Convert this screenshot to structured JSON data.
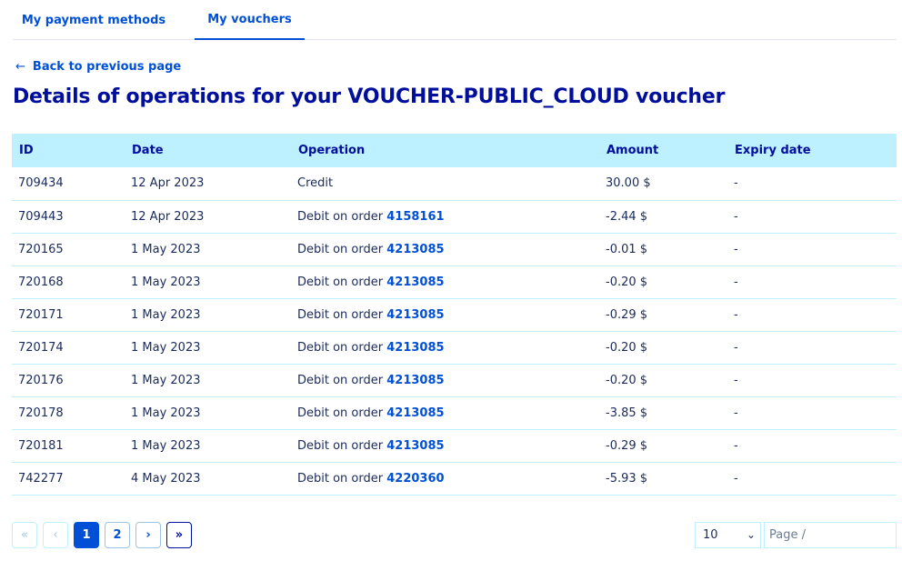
{
  "tabs": [
    {
      "label": "My payment methods"
    },
    {
      "label": "My vouchers"
    }
  ],
  "back_link": {
    "label": "Back to previous page"
  },
  "page_title": "Details of operations for your VOUCHER-PUBLIC_CLOUD voucher",
  "table": {
    "headers": [
      "ID",
      "Date",
      "Operation",
      "Amount",
      "Expiry date"
    ],
    "rows": [
      {
        "id": "709434",
        "date": "12 Apr 2023",
        "operation": "Credit",
        "order": "",
        "amount": "30.00 $",
        "expiry": "-"
      },
      {
        "id": "709443",
        "date": "12 Apr 2023",
        "operation": "Debit on order ",
        "order": "4158161",
        "amount": "-2.44 $",
        "expiry": "-"
      },
      {
        "id": "720165",
        "date": "1 May 2023",
        "operation": "Debit on order ",
        "order": "4213085",
        "amount": "-0.01 $",
        "expiry": "-"
      },
      {
        "id": "720168",
        "date": "1 May 2023",
        "operation": "Debit on order ",
        "order": "4213085",
        "amount": "-0.20 $",
        "expiry": "-"
      },
      {
        "id": "720171",
        "date": "1 May 2023",
        "operation": "Debit on order ",
        "order": "4213085",
        "amount": "-0.29 $",
        "expiry": "-"
      },
      {
        "id": "720174",
        "date": "1 May 2023",
        "operation": "Debit on order ",
        "order": "4213085",
        "amount": "-0.20 $",
        "expiry": "-"
      },
      {
        "id": "720176",
        "date": "1 May 2023",
        "operation": "Debit on order ",
        "order": "4213085",
        "amount": "-0.20 $",
        "expiry": "-"
      },
      {
        "id": "720178",
        "date": "1 May 2023",
        "operation": "Debit on order ",
        "order": "4213085",
        "amount": "-3.85 $",
        "expiry": "-"
      },
      {
        "id": "720181",
        "date": "1 May 2023",
        "operation": "Debit on order ",
        "order": "4213085",
        "amount": "-0.29 $",
        "expiry": "-"
      },
      {
        "id": "742277",
        "date": "4 May 2023",
        "operation": "Debit on order ",
        "order": "4220360",
        "amount": "-5.93 $",
        "expiry": "-"
      }
    ]
  },
  "pagination": {
    "first": "«",
    "prev": "‹",
    "pages": [
      "1",
      "2"
    ],
    "current": "1",
    "next": "›",
    "last": "»",
    "per_page": "10",
    "page_input_placeholder": "Page /"
  },
  "colors": {
    "primary": "#0050d7",
    "title": "#000e9c",
    "header_bg": "#bef1ff"
  }
}
